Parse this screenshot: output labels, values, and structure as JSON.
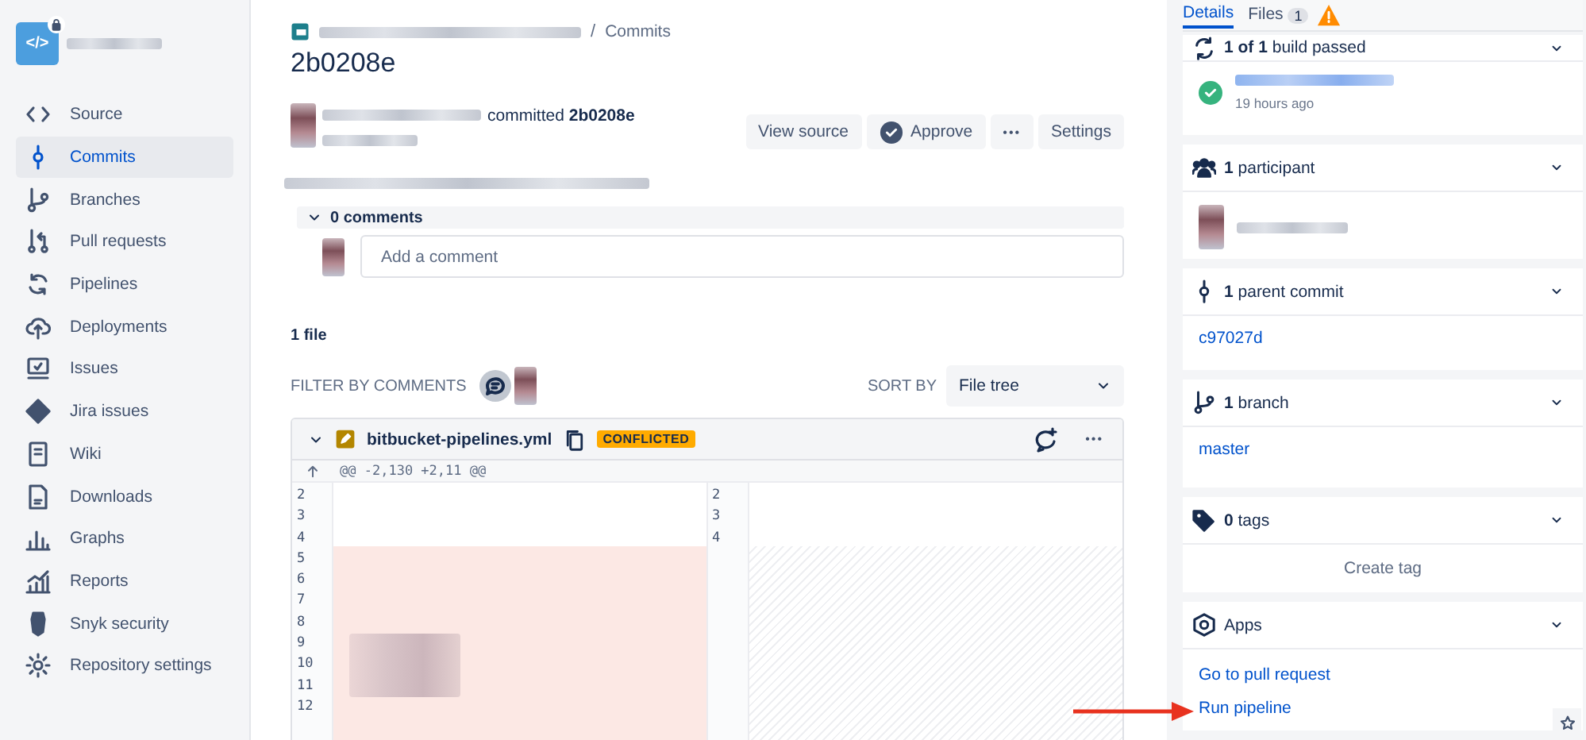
{
  "sidebar": {
    "repo_icon": "</>",
    "items": [
      {
        "label": "Source",
        "kind": "source",
        "selected": false
      },
      {
        "label": "Commits",
        "kind": "commits",
        "selected": true
      },
      {
        "label": "Branches",
        "kind": "branches",
        "selected": false
      },
      {
        "label": "Pull requests",
        "kind": "pulls",
        "selected": false
      },
      {
        "label": "Pipelines",
        "kind": "pipelines",
        "selected": false
      },
      {
        "label": "Deployments",
        "kind": "deployments",
        "selected": false
      },
      {
        "label": "Issues",
        "kind": "issues",
        "selected": false
      },
      {
        "label": "Jira issues",
        "kind": "jira",
        "selected": false
      },
      {
        "label": "Wiki",
        "kind": "wiki",
        "selected": false
      },
      {
        "label": "Downloads",
        "kind": "downloads",
        "selected": false
      },
      {
        "label": "Graphs",
        "kind": "graphs",
        "selected": false
      },
      {
        "label": "Reports",
        "kind": "reports",
        "selected": false
      },
      {
        "label": "Snyk security",
        "kind": "snyk",
        "selected": false
      },
      {
        "label": "Repository settings",
        "kind": "settings",
        "selected": false
      }
    ]
  },
  "breadcrumb": {
    "separator": "/",
    "current": "Commits"
  },
  "title": "2b0208e",
  "commit": {
    "text": "committed **2b0208e**"
  },
  "actions": [
    {
      "label": "View source",
      "kind": "text"
    },
    {
      "label": "Approve",
      "kind": "approve"
    },
    {
      "label": "•••",
      "kind": "more"
    },
    {
      "label": "Settings",
      "kind": "text"
    }
  ],
  "comments": {
    "label": "0 comments",
    "expanded": true,
    "placeholder": "Add a comment"
  },
  "files_count": "1 file",
  "filter": {
    "label": "FILTER BY COMMENTS"
  },
  "sort": {
    "label": "SORT BY",
    "value": "File tree"
  },
  "file": {
    "name": "bitbucket-pipelines.yml",
    "status": "CONFLICTED",
    "expanded": true,
    "hunk": "@@ -2,130 +2,11 @@",
    "more": "•••",
    "left_lines": [
      "2",
      "3",
      "4",
      "5",
      "6",
      "7",
      "8",
      "9",
      "10",
      "11",
      "12"
    ],
    "right_lines": [
      "2",
      "3",
      "4"
    ]
  },
  "details_tabs": [
    {
      "label": "Details",
      "selected": true
    },
    {
      "label": "Files",
      "count": "1",
      "warning": true,
      "selected": false
    }
  ],
  "panels": [
    {
      "kind": "builds",
      "title": "**1 of 1** build passed",
      "expanded": true,
      "time": "19 hours ago"
    },
    {
      "kind": "participants",
      "title": "**1** participant",
      "expanded": true
    },
    {
      "kind": "parents",
      "title": "**1** parent commit",
      "expanded": true,
      "links": [
        "c97027d"
      ]
    },
    {
      "kind": "branches",
      "title": "**1** branch",
      "expanded": true,
      "links": [
        "master"
      ]
    },
    {
      "kind": "tags",
      "title": "**0** tags",
      "expanded": true,
      "button": "Create tag"
    },
    {
      "kind": "apps",
      "title": "Apps",
      "expanded": true,
      "links": [
        "Go to pull request",
        "Run pipeline"
      ]
    }
  ]
}
